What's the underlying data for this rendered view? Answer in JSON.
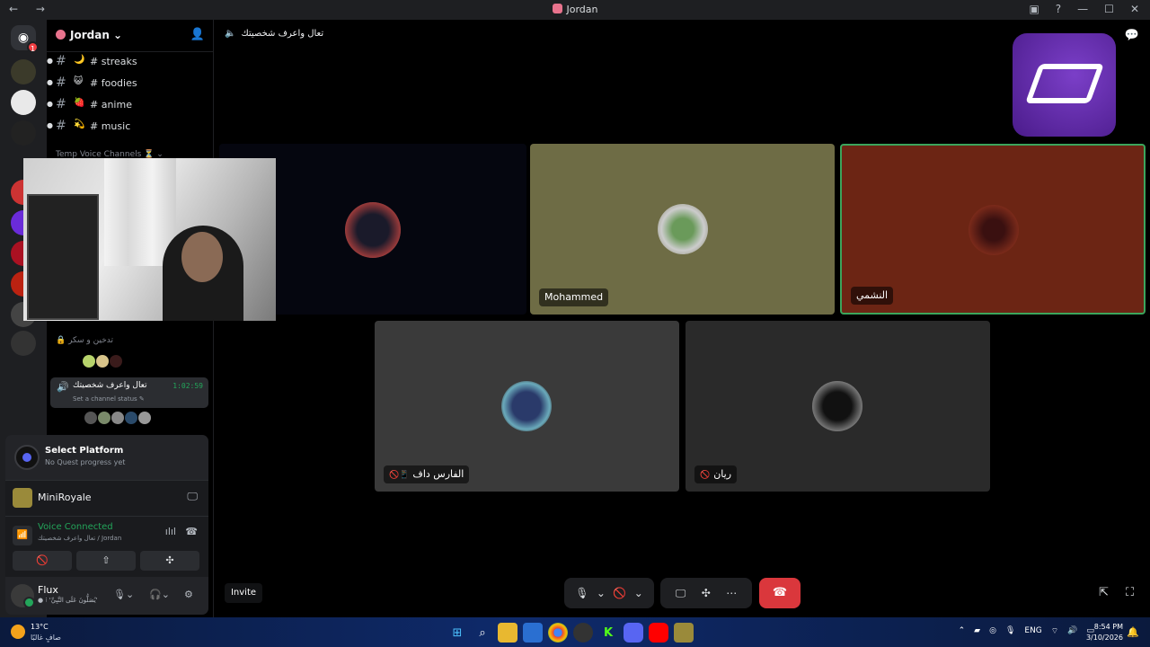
{
  "window": {
    "title": "Jordan",
    "nav": "← →",
    "controls": [
      "▣",
      "?",
      "—",
      "☐",
      "✕"
    ]
  },
  "server_rail": {
    "home_icon": "discord-icon",
    "home_badge": "1"
  },
  "sidebar": {
    "guild_name": "Jordan",
    "guild_chevron": "⌄",
    "add_member_icon": "person-add-icon",
    "channels": [
      {
        "emoji": "🌙",
        "name": "# streaks"
      },
      {
        "emoji": "😺",
        "name": "# foodies"
      },
      {
        "emoji": "🍓",
        "name": "# anime"
      },
      {
        "emoji": "💫",
        "name": "# music"
      }
    ],
    "category": "Temp Voice Channels ⏳ ⌄",
    "locked_channel": "🔒 تدخين و سكر",
    "active_voice": {
      "name": "تعال واعرف شخصيتك",
      "time": "1:02:59",
      "status": "Set a channel status ✎"
    }
  },
  "quest": {
    "title": "Select Platform",
    "subtitle": "No Quest progress yet"
  },
  "game": {
    "name": "MiniRoyale"
  },
  "voice_panel": {
    "title": "Voice Connected",
    "subtitle": "تعال واعرف شخصيتك / Jordan",
    "buttons": [
      "🚫",
      "⇧",
      "✣"
    ]
  },
  "user": {
    "name": "Flux",
    "status": "● ⁝ 'يُصَلُّونَ عَلَى النَّبِيِّ'"
  },
  "call": {
    "channel_name": "تعال واعرف شخصيتك",
    "tiles": [
      {
        "label": ""
      },
      {
        "label": "Mohammed"
      },
      {
        "label": "النشمي"
      },
      {
        "label": "الفارس داف"
      },
      {
        "label": "ريان"
      }
    ],
    "invite_label": "Invite"
  },
  "colors": {
    "accent": "#5865f2",
    "connected": "#23a55a",
    "danger": "#da373c"
  },
  "taskbar": {
    "temperature": "13°C",
    "weather": "صافٍ غالبًا",
    "tray_lang": "ENG",
    "time": "8:54 PM",
    "date": "3/10/2026"
  }
}
